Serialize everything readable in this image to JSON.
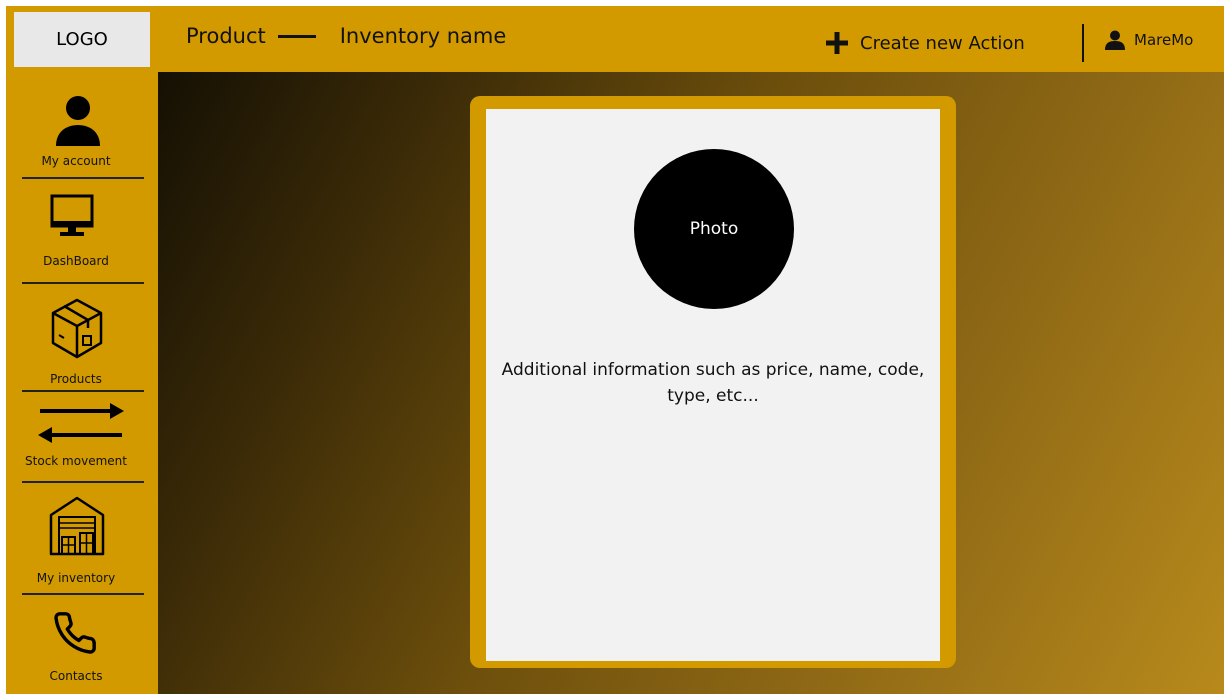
{
  "header": {
    "logo": "LOGO",
    "product_label": "Product",
    "inventory_label": "Inventory name",
    "create_action_label": "Create new Action",
    "username": "MareMo"
  },
  "sidebar": {
    "items": [
      {
        "label": "My account",
        "icon": "person-icon"
      },
      {
        "label": "DashBoard",
        "icon": "monitor-icon"
      },
      {
        "label": "Products",
        "icon": "box-icon"
      },
      {
        "label": "Stock movement",
        "icon": "arrows-icon"
      },
      {
        "label": "My inventory",
        "icon": "warehouse-icon"
      },
      {
        "label": "Contacts",
        "icon": "phone-icon"
      }
    ]
  },
  "card": {
    "photo_label": "Photo",
    "info_text": "Additional information such as price, name, code, type, etc..."
  },
  "colors": {
    "accent": "#d39a00",
    "card_background": "#f2f2f2",
    "logo_background": "#e8e8e8"
  }
}
